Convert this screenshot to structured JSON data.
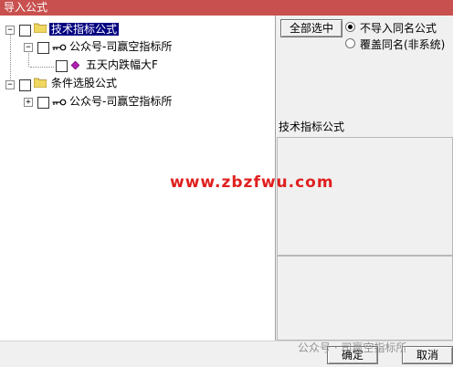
{
  "window": {
    "title": "导入公式"
  },
  "tree": {
    "root1": {
      "label": "技术指标公式",
      "expander": "−"
    },
    "root1_child": {
      "label": "公众号-司赢空指标所",
      "expander": "−"
    },
    "root1_grandchild": {
      "label": "五天内跌幅大F"
    },
    "root2": {
      "label": "条件选股公式",
      "expander": "−"
    },
    "root2_child": {
      "label": "公众号-司赢空指标所",
      "expander": "+"
    }
  },
  "options": {
    "select_all_label": "全部选中",
    "radio_skip_label": "不导入同名公式",
    "radio_overwrite_label": "覆盖同名(非系统)",
    "selected": "radio_skip"
  },
  "panel_header": "技术指标公式",
  "watermark": {
    "site": "www.zbzfwu.com",
    "wechat": "公众号 · 司赢空指标所"
  },
  "buttons": {
    "ok": "确定",
    "cancel": "取消"
  },
  "colors": {
    "titlebar": "#c8504e",
    "selection": "#000080",
    "watermark": "#e02020"
  }
}
